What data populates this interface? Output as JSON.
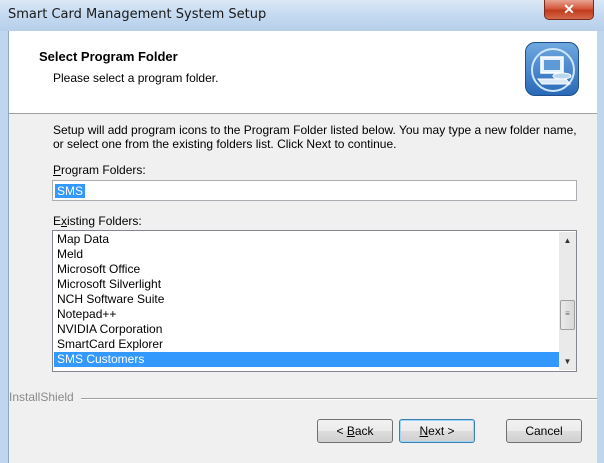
{
  "window": {
    "title": "Smart Card Management System Setup",
    "close_glyph": "✕"
  },
  "header": {
    "title": "Select Program Folder",
    "subtitle": "Please select a program folder.",
    "icon": "setup-computer-icon"
  },
  "description": "Setup will add program icons to the Program Folder listed below.  You may type a new folder name, or select one from the existing folders list.  Click Next to continue.",
  "program_folders": {
    "label_accel": "P",
    "label_rest": "rogram Folders:",
    "value": "SMS"
  },
  "existing_folders": {
    "label_pre": "E",
    "label_accel": "x",
    "label_rest": "isting Folders:",
    "items": [
      "Map Data",
      "Meld",
      "Microsoft Office",
      "Microsoft Silverlight",
      "NCH Software Suite",
      "Notepad++",
      "NVIDIA Corporation",
      "SmartCard Explorer",
      "SMS Customers"
    ],
    "selected": "SMS Customers"
  },
  "brand": "InstallShield",
  "buttons": {
    "back": {
      "pre": "< ",
      "accel": "B",
      "rest": "ack"
    },
    "next": {
      "accel": "N",
      "rest": "ext >"
    },
    "cancel": "Cancel"
  },
  "colors": {
    "selection": "#3399ff",
    "dialog_bg": "#f0f0f0",
    "frame": "#c0d6ee"
  }
}
